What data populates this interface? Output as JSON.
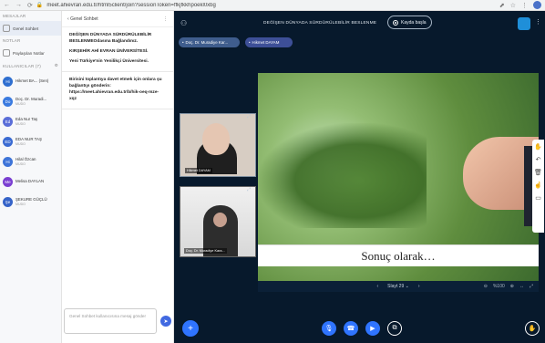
{
  "browser": {
    "url": "meet.ahievran.edu.tr/html5client/join?sessionToken=ffkjfkkhpoekl0xbg"
  },
  "left_panel": {
    "section_messages": "MESAJLAR",
    "chat_item": "Genel Sohbet",
    "section_notes": "NOTLAR",
    "notes_item": "Paylaşılan Notlar",
    "section_users": "KULLANICILAR (7)",
    "users": [
      {
        "initials": "Hi",
        "name": "Hikmet BA... (Sen)",
        "status": "",
        "color": "#2f6fd0"
      },
      {
        "initials": "Do",
        "name": "Doç. Dr. Muradi...",
        "status": "MUDO",
        "color": "#3b7be0"
      },
      {
        "initials": "Ed",
        "name": "Eda Nur Taş",
        "status": "MUDO",
        "color": "#5a6ed8"
      },
      {
        "initials": "ED",
        "name": "EDA NUR TAŞ",
        "status": "MUDO",
        "color": "#3a6bd2"
      },
      {
        "initials": "Hi",
        "name": "Hilal Özcan",
        "status": "MUDO",
        "color": "#3e74d8"
      },
      {
        "initials": "Me",
        "name": "Melisa DAYLAN",
        "status": "",
        "color": "#7a3fd1"
      },
      {
        "initials": "Şe",
        "name": "ŞEKURE GÜÇLÜ",
        "status": "MUDO",
        "color": "#3563c8"
      }
    ]
  },
  "chat": {
    "back_label": "Genel Sohbet",
    "welcome_title": "DEĞİŞEN DÜNYADA SÜRDÜRÜLEBİLİR BESLENME",
    "welcome_suffix": "Odasına Bağlandınız.",
    "university": "KIRŞEHİR AHİ EVRAN ÜNİVERSİTESİ.",
    "motto": "Yeni Türkiye'nin Yenilikçi Üniversitesi.",
    "invite_text": "Birisini toplantıya davet etmek için onlara şu bağlantıyı gönderin:",
    "invite_link": "https://meet.ahievran.edu.tr/b/hik-oeq-mze-xqz",
    "compose_placeholder": "Genel Sohbet kullanıcısına mesaj gönder",
    "send_icon": "send-icon"
  },
  "meeting": {
    "title": "DEĞİŞEN DÜNYADA SÜRDÜRÜLEBİLİR BESLENME",
    "record_label": "Kayda başla",
    "presenter_pill": "Doç. Dr. Muradiye Kar...",
    "self_pill": "Hikmet DAYAM",
    "video1_label": "Hikmet DAYAM",
    "video2_label": "Doç. Dr. Muradiye Kara...",
    "slide_caption": "Sonuç olarak…",
    "slide_nav": "Slayt 29",
    "zoom": "%100",
    "colors": {
      "app_bg": "#07192c",
      "accent": "#2f74ff",
      "recording_border": "#a7b6c6"
    }
  }
}
